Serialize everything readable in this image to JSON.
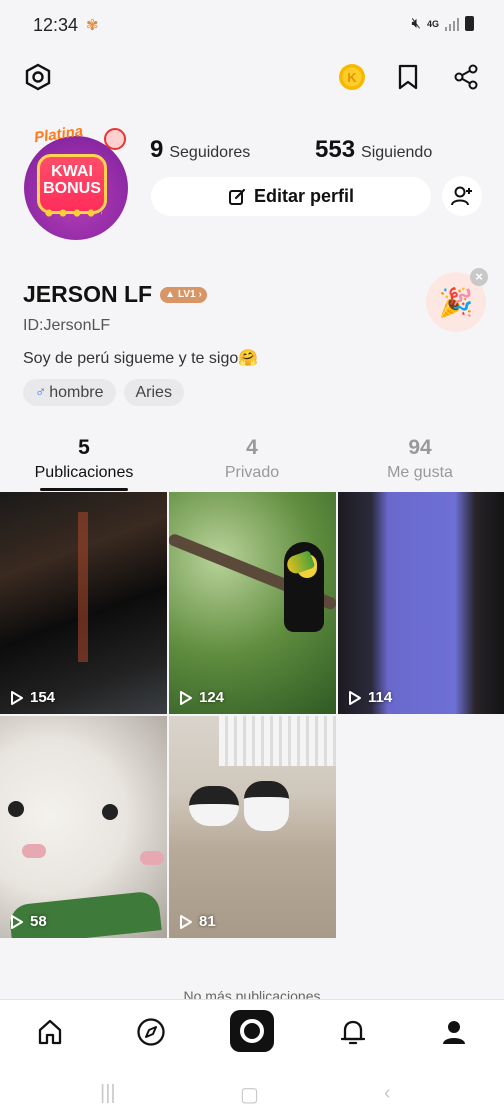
{
  "status_bar": {
    "time": "12:34",
    "network": "4G"
  },
  "profile": {
    "avatar_badge_lines": [
      "KWAI",
      "BONUS"
    ],
    "avatar_banner": "Platina",
    "followers": {
      "count": "9",
      "label": "Seguidores"
    },
    "following": {
      "count": "553",
      "label": "Siguiendo"
    },
    "edit_label": "Editar perfil",
    "name": "JERSON LF",
    "level": "LV1",
    "id": "ID:JersonLF",
    "bio": "Soy de perú sigueme y te sigo🤗",
    "tags": [
      {
        "icon": "male-icon",
        "label": "hombre"
      },
      {
        "label": "Aries"
      }
    ]
  },
  "tabs": [
    {
      "count": "5",
      "label": "Publicaciones",
      "active": true
    },
    {
      "count": "4",
      "label": "Privado",
      "active": false
    },
    {
      "count": "94",
      "label": "Me gusta",
      "active": false
    }
  ],
  "posts": [
    {
      "views": "154"
    },
    {
      "views": "124"
    },
    {
      "views": "114"
    },
    {
      "views": "58"
    },
    {
      "views": "81"
    }
  ],
  "footer_text": "No más publicaciones",
  "bottom_nav": [
    "home-icon",
    "compass-icon",
    "camera-icon",
    "bell-icon",
    "profile-icon"
  ],
  "colors": {
    "accent": "#111111",
    "tag_male": "#2a7de1",
    "level_badge": "#d89565"
  }
}
